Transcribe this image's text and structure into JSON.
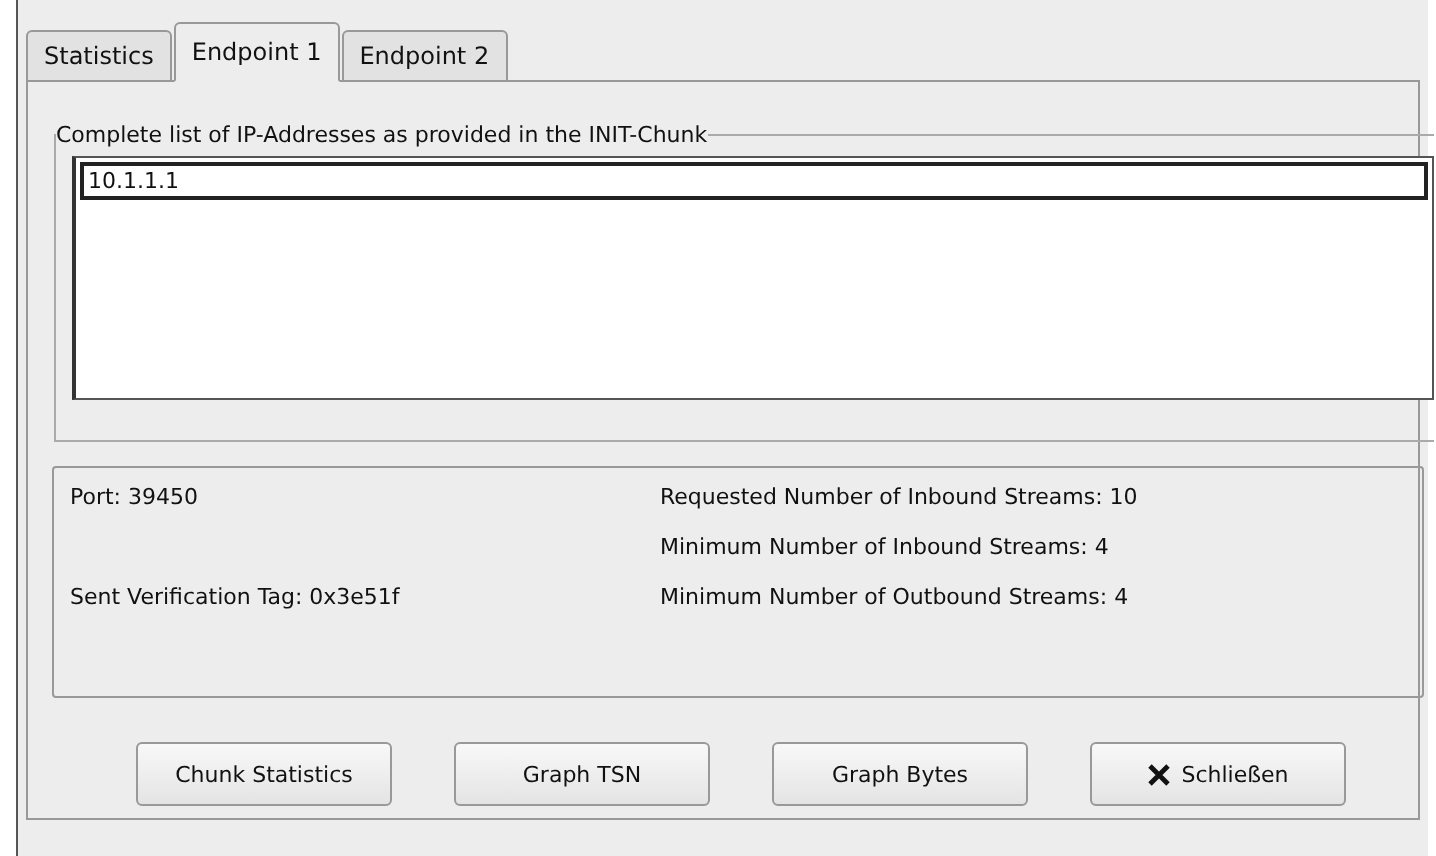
{
  "tabs": [
    {
      "label": "Statistics",
      "selected": false
    },
    {
      "label": "Endpoint 1",
      "selected": true
    },
    {
      "label": "Endpoint 2",
      "selected": false
    }
  ],
  "address_group": {
    "title": "Complete list of IP-Addresses as provided in the INIT-Chunk",
    "addresses": [
      "10.1.1.1"
    ]
  },
  "info_rows": [
    {
      "left": "Port: 39450",
      "right": "Requested Number of Inbound Streams: 10"
    },
    {
      "right": "Minimum Number of Inbound Streams: 4"
    },
    {
      "left": "Sent Verification Tag: 0x3e51f",
      "right": "Minimum Number of Outbound Streams: 4"
    }
  ],
  "buttons": [
    {
      "label": "Chunk Statistics",
      "kind": "plain"
    },
    {
      "label": "Graph TSN",
      "kind": "plain"
    },
    {
      "label": "Graph Bytes",
      "kind": "plain"
    },
    {
      "label": "Schließen",
      "kind": "close"
    }
  ]
}
